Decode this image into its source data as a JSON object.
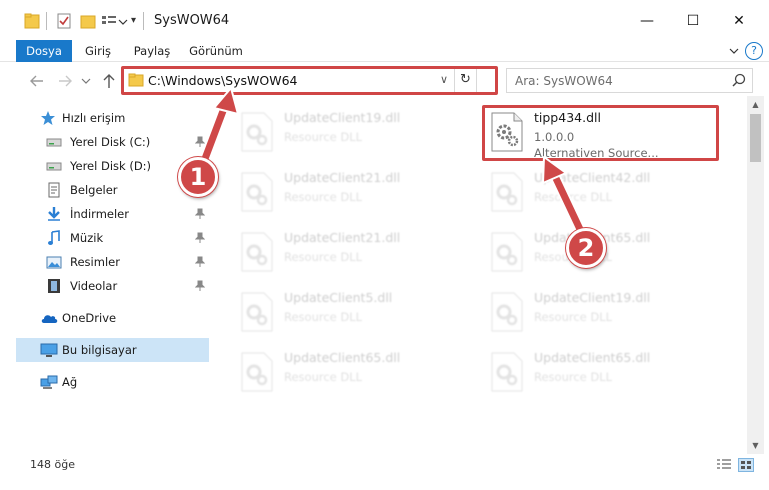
{
  "window": {
    "title": "SysWOW64",
    "buttons": {
      "minimize": "—",
      "maximize": "☐",
      "close": "✕"
    }
  },
  "ribbon": {
    "tabs": [
      "Dosya",
      "Giriş",
      "Paylaş",
      "Görünüm"
    ],
    "help": "?"
  },
  "address_bar": {
    "path": "C:\\Windows\\SysWOW64",
    "refresh": "↻",
    "dropdown": "∨"
  },
  "search": {
    "placeholder": "Ara: SysWOW64"
  },
  "sidebar": {
    "items": [
      {
        "label": "Hızlı erişim",
        "icon": "star-icon",
        "pinned": false
      },
      {
        "label": "Yerel Disk (C:)",
        "icon": "drive-icon",
        "pinned": true
      },
      {
        "label": "Yerel Disk (D:)",
        "icon": "drive-icon",
        "pinned": true
      },
      {
        "label": "Belgeler",
        "icon": "document-icon",
        "pinned": true
      },
      {
        "label": "İndirmeler",
        "icon": "download-icon",
        "pinned": true
      },
      {
        "label": "Müzik",
        "icon": "music-icon",
        "pinned": true
      },
      {
        "label": "Resimler",
        "icon": "picture-icon",
        "pinned": true
      },
      {
        "label": "Videolar",
        "icon": "video-icon",
        "pinned": true
      },
      {
        "label": "OneDrive",
        "icon": "cloud-icon",
        "pinned": false
      },
      {
        "label": "Bu bilgisayar",
        "icon": "computer-icon",
        "pinned": false,
        "selected": true
      },
      {
        "label": "Ağ",
        "icon": "network-icon",
        "pinned": false
      }
    ]
  },
  "files": [
    {
      "name": "UpdateClient19.dll",
      "sub": "Resource DLL",
      "faded": true
    },
    {
      "name": "tipp434.dll",
      "sub": "1.0.0.0",
      "sub2": "Alternativen Source...",
      "faded": false
    },
    {
      "name": "UpdateClient21.dll",
      "sub": "Resource DLL",
      "faded": true
    },
    {
      "name": "UpdateClient42.dll",
      "sub": "Resource DLL",
      "faded": true
    },
    {
      "name": "UpdateClient21.dll",
      "sub": "Resource DLL",
      "faded": true
    },
    {
      "name": "UpdateClient65.dll",
      "sub": "Resource DLL",
      "faded": true
    },
    {
      "name": "UpdateClient5.dll",
      "sub": "Resource DLL",
      "faded": true
    },
    {
      "name": "UpdateClient19.dll",
      "sub": "Resource DLL",
      "faded": true
    },
    {
      "name": "UpdateClient65.dll",
      "sub": "Resource DLL",
      "faded": true
    },
    {
      "name": "UpdateClient65.dll",
      "sub": "Resource DLL",
      "faded": true
    }
  ],
  "status": {
    "count": "148 öğe"
  },
  "annotations": {
    "step1": "1",
    "step2": "2",
    "color": "#d04646"
  }
}
